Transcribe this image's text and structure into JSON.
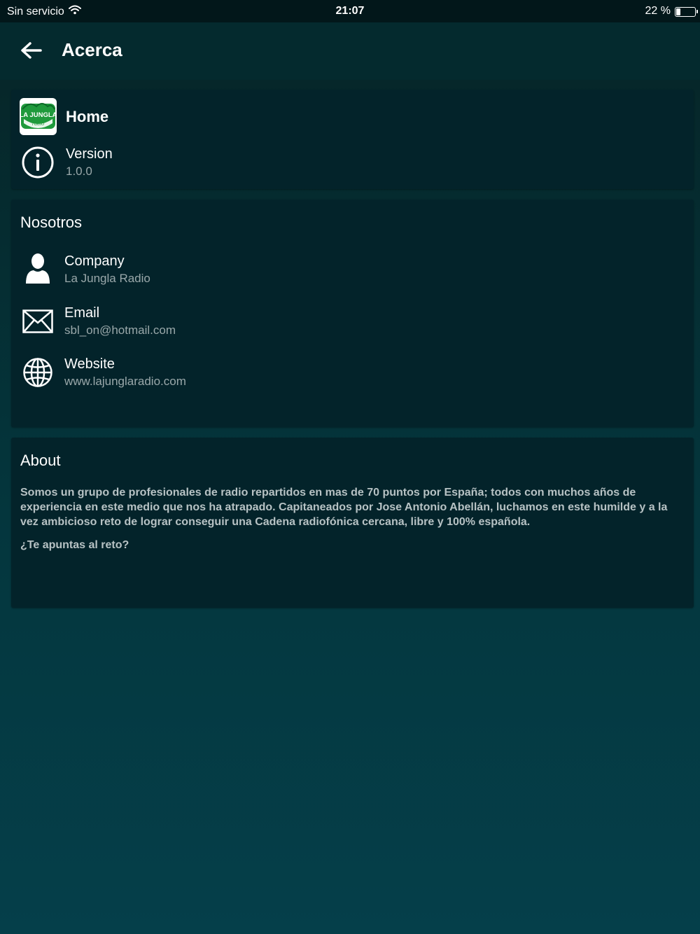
{
  "status_bar": {
    "carrier": "Sin servicio",
    "time": "21:07",
    "battery_label": "22 %",
    "battery_level": 0.22
  },
  "app_bar": {
    "title": "Acerca",
    "back_icon": "arrow-left-icon"
  },
  "home_card": {
    "app_name": "Home",
    "logo_text_top": "LA JUNGLA",
    "logo_text_bottom": "radio",
    "version_label": "Version",
    "version_value": "1.0.0",
    "version_icon": "info-icon"
  },
  "us_card": {
    "title": "Nosotros",
    "items": [
      {
        "icon": "person-icon",
        "label": "Company",
        "value": "La Jungla Radio"
      },
      {
        "icon": "envelope-icon",
        "label": "Email",
        "value": "sbl_on@hotmail.com"
      },
      {
        "icon": "globe-icon",
        "label": "Website",
        "value": "www.lajunglaradio.com"
      }
    ]
  },
  "about_card": {
    "title": "About",
    "body": "Somos un grupo de profesionales de radio repartidos en mas de 70 puntos por España; todos con muchos años de experiencia en este medio que nos ha atrapado. Capitaneados por Jose Antonio Abellán, luchamos en este humilde y a la vez ambicioso reto de lograr conseguir una Cadena radiofónica cercana, libre y 100% española.",
    "question": "¿Te apuntas al reto?"
  },
  "colors": {
    "background_top": "#062426",
    "background_bottom": "#053f4a",
    "card": "#03232a",
    "app_bar": "#042a2e",
    "secondary_text": "#9aa8aa",
    "logo_green": "#1f9a3c"
  }
}
